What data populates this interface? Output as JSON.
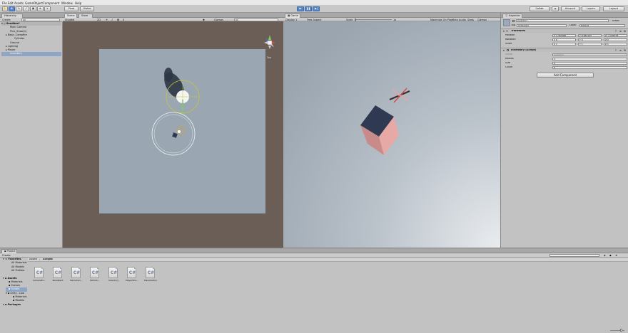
{
  "menu": [
    "File",
    "Edit",
    "Assets",
    "GameObject",
    "Component",
    "Window",
    "Help"
  ],
  "toolbar": {
    "pivot": "Pivot",
    "global": "Global",
    "collab": "Collab",
    "account": "Account",
    "layers": "Layers",
    "layout": "Layout"
  },
  "hierarchy": {
    "tab": "Hierarchy",
    "create": "Create",
    "search_placeholder": "All",
    "scene": "Sandbox*",
    "items": [
      "Main Camera",
      "Pine_Snow(1)",
      "Basic_Campfire",
      "Cylinder",
      "Ground",
      "Lighting",
      "Player",
      "Inventory"
    ]
  },
  "scene_view": {
    "tab": "Scene",
    "second_tab": "Store",
    "shading": "Shaded",
    "mode": "2D",
    "gizmos": "Gizmos",
    "search": "All",
    "persp": "Top"
  },
  "game_view": {
    "tab": "Game",
    "display": "Display 1",
    "aspect": "Free Aspect",
    "scale_label": "Scale",
    "scale_value": "1x",
    "maximize": "Maximize On Play",
    "mute": "Mute Audio",
    "stats": "Stats",
    "gizmos": "Gizmos"
  },
  "inspector": {
    "tab": "Inspector",
    "object_name": "Inventory",
    "static_label": "Static",
    "tag_label": "Tag",
    "tag_value": "Untagged",
    "layer_label": "Layer",
    "layer_value": "Default",
    "transform": {
      "title": "Transform",
      "position_label": "Position",
      "rotation_label": "Rotation",
      "scale_label": "Scale",
      "position": [
        "X 1.383080",
        "Y 8.962145",
        "Z -1.189705"
      ],
      "rotation": [
        "X 0",
        "Y 0",
        "Z 0"
      ],
      "scale": [
        "X 1",
        "Y 1",
        "Z 1"
      ]
    },
    "script": {
      "title": "Inventory (Script)",
      "script_label": "Script",
      "script_value": "Inventory",
      "radius_label": "Radius",
      "radius_value": "1",
      "size_label": "Size",
      "size_value": "4",
      "count_label": "Count",
      "count_value": "0"
    },
    "add_component": "Add Component"
  },
  "project": {
    "tab": "Project",
    "create": "Create",
    "favorites": "Favorites",
    "fav_items": [
      "All Materials",
      "All Models",
      "All Prefabs"
    ],
    "assets": "Assets",
    "asset_folders": [
      "Materials",
      "Scenes",
      "Scripts",
      "Unity - Low"
    ],
    "sub_folders": [
      "Materials",
      "Models"
    ],
    "packages": "Packages",
    "breadcrumb": [
      "Assets",
      "Scripts"
    ],
    "files": [
      "CameraFo...",
      "Persistent",
      "ItemsCarr...",
      "InDrivin...",
      "Inventory",
      "PlayerCha...",
      "PlaceCartrio..."
    ]
  },
  "colors": {
    "scene_bg": "#6a5e57",
    "ground": "#9aa7b2",
    "accent": "#5b87c4",
    "cube_top": "#2f3a52",
    "cube_side": "#e7a9a6"
  }
}
